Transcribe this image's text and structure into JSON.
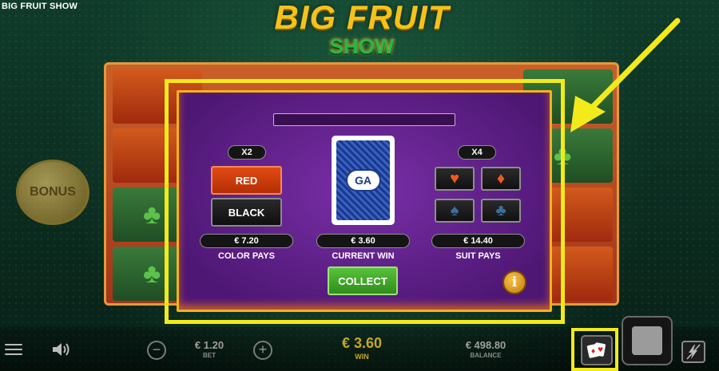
{
  "window": {
    "title": "BIG FRUIT SHOW"
  },
  "logo": {
    "line1": "BIG FRUIT",
    "line2": "SHOW"
  },
  "bonus": {
    "label": "BONUS"
  },
  "gamble": {
    "color": {
      "multiplier": "X2",
      "red_label": "RED",
      "black_label": "BLACK",
      "pays_value": "€ 7.20",
      "pays_label": "COLOR PAYS"
    },
    "card": {
      "logo_text": "GA",
      "current_win_value": "€ 3.60",
      "current_win_label": "CURRENT WIN"
    },
    "suit": {
      "multiplier": "X4",
      "pays_value": "€ 14.40",
      "pays_label": "SUIT PAYS",
      "suits": [
        {
          "icon": "heart-icon",
          "glyph": "♥"
        },
        {
          "icon": "diamond-icon",
          "glyph": "♦"
        },
        {
          "icon": "spade-icon",
          "glyph": "♠"
        },
        {
          "icon": "club-icon",
          "glyph": "♣"
        }
      ]
    },
    "collect_label": "COLLECT",
    "info_label": "i"
  },
  "bottom_bar": {
    "bet": {
      "value": "€ 1.20",
      "label": "BET",
      "minus": "−",
      "plus": "+"
    },
    "win": {
      "value": "€ 3.60",
      "label": "WIN"
    },
    "balance": {
      "value": "€ 498.80",
      "label": "BALANCE"
    }
  },
  "colors": {
    "highlight": "#f2ea1a",
    "panel_purple": "#5e1e88",
    "red_button": "#e24a12",
    "collect_green": "#4fb631",
    "win_gold": "#c9a628"
  }
}
